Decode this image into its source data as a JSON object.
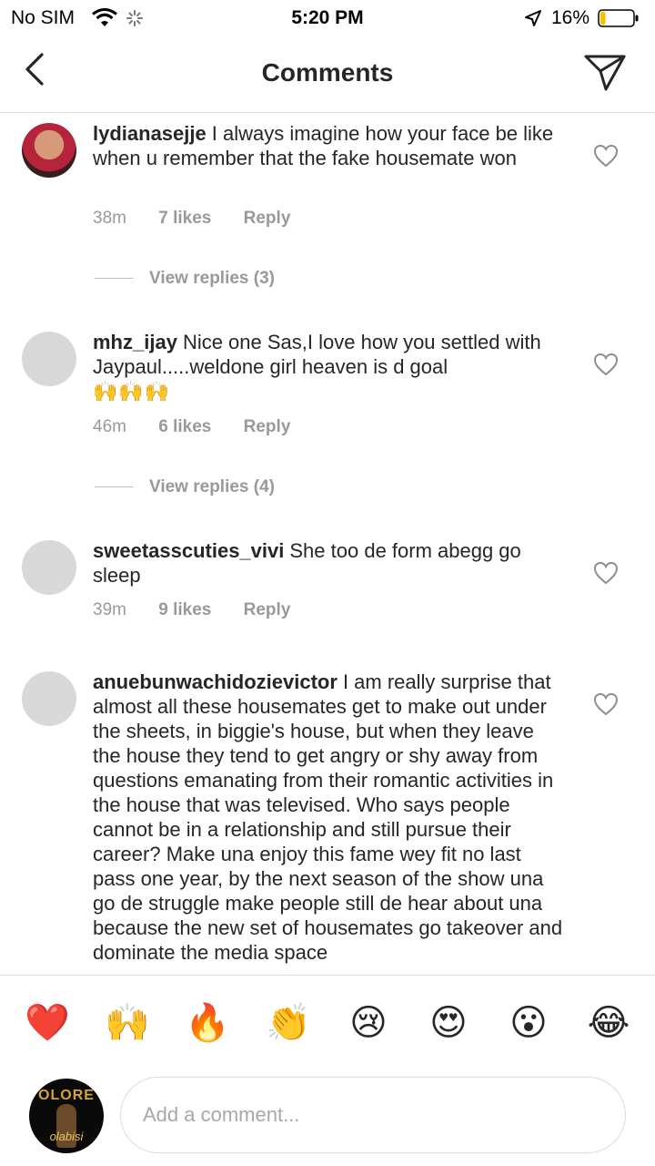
{
  "status_bar": {
    "carrier": "No SIM",
    "time": "5:20 PM",
    "battery": "16%",
    "battery_level": 0.16
  },
  "header": {
    "title": "Comments"
  },
  "comments": [
    {
      "username": "lydianasejje",
      "text": "I always imagine how your face be like when u remember that the fake housemate won",
      "time": "38m",
      "likes": "7 likes",
      "reply": "Reply",
      "view_replies": "View replies (3)"
    },
    {
      "username": "mhz_ijay",
      "text": "Nice one Sas,I love how you settled with Jaypaul.....weldone girl heaven is d goal",
      "emojis": "🙌🙌🙌",
      "time": "46m",
      "likes": "6 likes",
      "reply": "Reply",
      "view_replies": "View replies (4)"
    },
    {
      "username": "sweetasscuties_vivi",
      "text": "She too de form abegg go sleep",
      "time": "39m",
      "likes": "9 likes",
      "reply": "Reply"
    },
    {
      "username": "anuebunwachidozievictor",
      "text": "I am really surprise that almost all these housemates get to make out  under the sheets, in biggie's house, but when they leave the house they tend to get angry or shy away from questions emanating from their romantic activities in the house that was televised. Who says people cannot be in a relationship and still pursue their career? Make una enjoy this fame wey fit no last pass one year, by the next season of the show una go de struggle make people still de hear about una because the new set of housemates go takeover and dominate the media space"
    }
  ],
  "emoji_bar": [
    "❤️",
    "🙌",
    "🔥",
    "👏",
    "😢",
    "😍",
    "😮",
    "😂"
  ],
  "composer": {
    "avatar_brand": "OLORE",
    "avatar_script": "olabisi",
    "placeholder": "Add a comment..."
  }
}
